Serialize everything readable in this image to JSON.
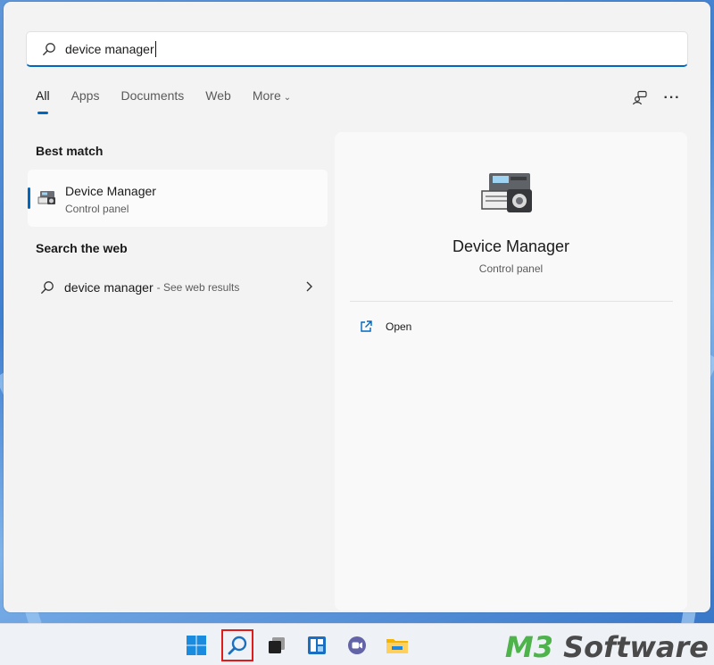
{
  "search": {
    "query": "device manager"
  },
  "tabs": [
    {
      "label": "All",
      "active": true
    },
    {
      "label": "Apps",
      "active": false
    },
    {
      "label": "Documents",
      "active": false
    },
    {
      "label": "Web",
      "active": false
    },
    {
      "label": "More",
      "active": false
    }
  ],
  "sections": {
    "best_match": "Best match",
    "search_web": "Search the web"
  },
  "best_match": {
    "title": "Device Manager",
    "subtitle": "Control panel"
  },
  "web_result": {
    "query": "device manager",
    "suffix": "- See web results"
  },
  "preview": {
    "title": "Device Manager",
    "subtitle": "Control panel",
    "actions": [
      {
        "label": "Open",
        "icon": "open-external-icon"
      }
    ]
  },
  "taskbar": {
    "items": [
      "start-icon",
      "search-icon",
      "task-view-icon",
      "widgets-icon",
      "teams-chat-icon",
      "file-explorer-icon"
    ],
    "highlighted": "search-icon"
  },
  "watermark": {
    "brand": "M3",
    "product": "Software"
  },
  "colors": {
    "accent": "#0067c0",
    "highlight_border": "#e01b1b",
    "watermark_green": "#4db34a"
  }
}
